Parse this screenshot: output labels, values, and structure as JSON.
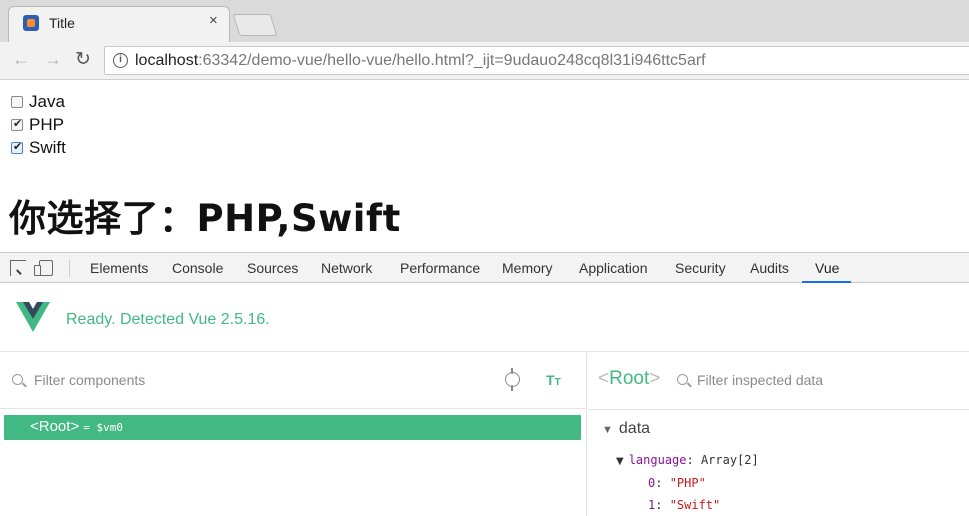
{
  "browser": {
    "tab_title": "Title",
    "tab_close": "×",
    "url_host": "localhost",
    "url_rest": ":63342/demo-vue/hello-vue/hello.html?_ijt=9udauo248cq8l31i946ttc5arf"
  },
  "page": {
    "checkboxes": [
      {
        "label": "Java",
        "checked": false
      },
      {
        "label": "PHP",
        "checked": true
      },
      {
        "label": "Swift",
        "checked": true
      }
    ],
    "result_text": "你选择了：PHP,Swift"
  },
  "devtools": {
    "tabs": [
      "Elements",
      "Console",
      "Sources",
      "Network",
      "Performance",
      "Memory",
      "Application",
      "Security",
      "Audits",
      "Vue"
    ],
    "active_tab": "Vue"
  },
  "vue": {
    "status": "Ready. Detected Vue 2.5.16.",
    "filter_components_placeholder": "Filter components",
    "tree_root": "<Root>",
    "tree_vm": "= $vm0",
    "inspected_name": "Root",
    "filter_data_placeholder": "Filter inspected data",
    "data_section_title": "data",
    "data": {
      "key": "language",
      "type": "Array[2]",
      "items": [
        {
          "index": "0",
          "value": "\"PHP\""
        },
        {
          "index": "1",
          "value": "\"Swift\""
        }
      ]
    },
    "brand_color": "#42b983"
  }
}
